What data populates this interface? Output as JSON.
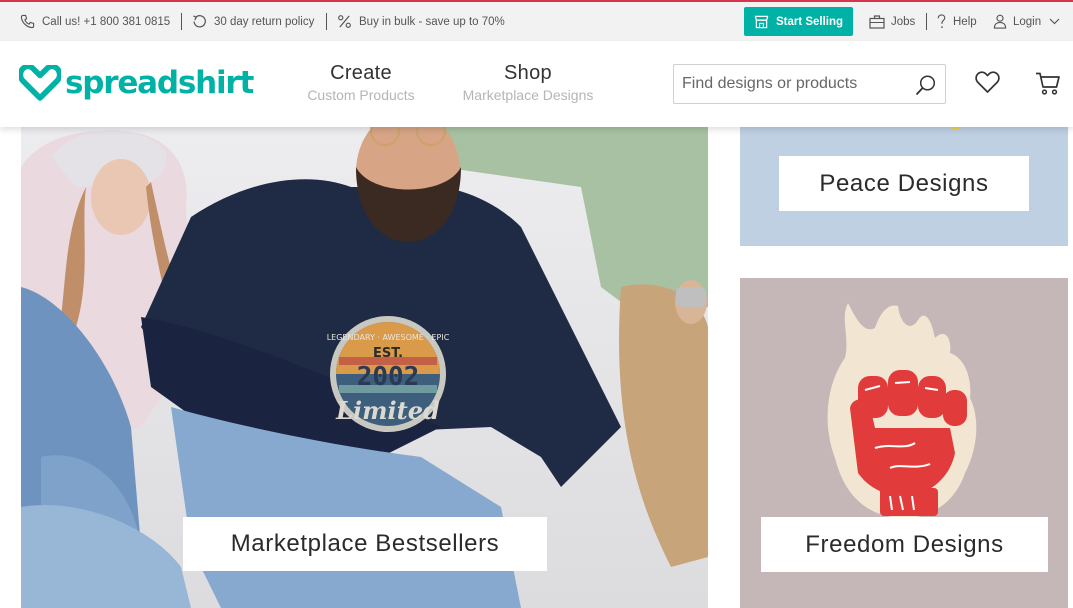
{
  "topbar": {
    "phone": "Call us! +1 800 381 0815",
    "returns": "30 day return policy",
    "bulk": "Buy in bulk - save up to 70%",
    "start_selling": "Start Selling",
    "jobs": "Jobs",
    "help": "Help",
    "login": "Login"
  },
  "header": {
    "logo": "spreadshirt",
    "nav": [
      {
        "title": "Create",
        "subtitle": "Custom Products"
      },
      {
        "title": "Shop",
        "subtitle": "Marketplace Designs"
      }
    ],
    "search_placeholder": "Find designs or products"
  },
  "tiles": {
    "main": {
      "label": "Marketplace Bestsellers",
      "shirt_print_top": "LEGENDARY · AWESOME · EPIC",
      "shirt_print_est": "EST.",
      "shirt_print_year": "2002",
      "shirt_print_bottom": "Limited"
    },
    "peace": {
      "label": "Peace Designs"
    },
    "freedom": {
      "label": "Freedom Designs"
    }
  },
  "colors": {
    "brand": "#00b2a5",
    "accent_line": "#d7354c",
    "peace_bg": "#bfd0e3",
    "freedom_bg": "#c5b7b7",
    "fist": "#e23b3b"
  },
  "icons": [
    "phone-icon",
    "return-icon",
    "percent-icon",
    "store-icon",
    "briefcase-icon",
    "question-icon",
    "user-icon",
    "chevron-down-icon",
    "search-icon",
    "heart-icon",
    "cart-icon"
  ]
}
